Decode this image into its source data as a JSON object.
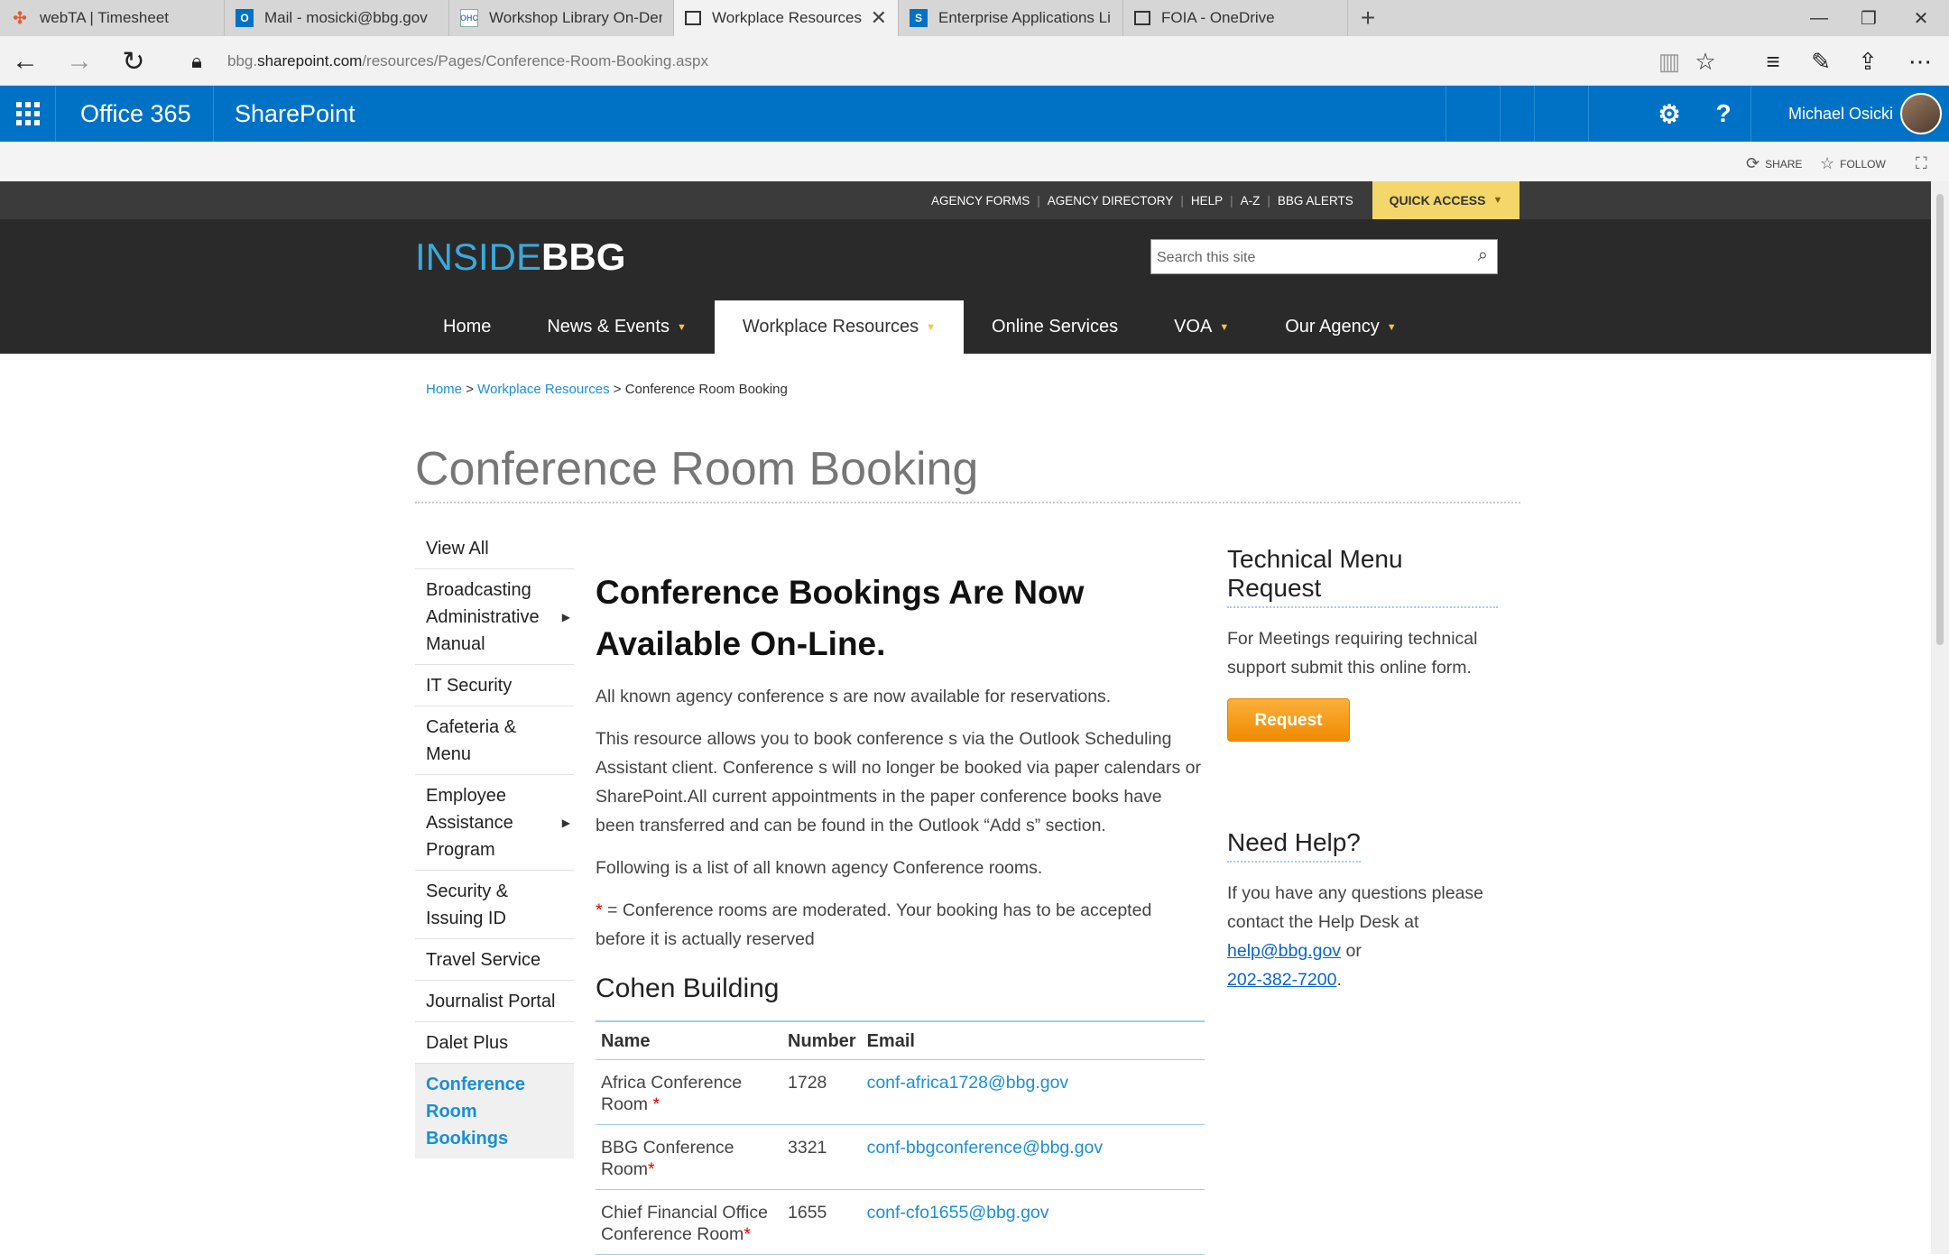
{
  "browser": {
    "tabs": [
      {
        "title": "webTA | Timesheet",
        "icon": "webta-favicon",
        "color": "#e65c2e"
      },
      {
        "title": "Mail - mosicki@bbg.gov",
        "icon": "outlook-favicon",
        "color": "#0072c6"
      },
      {
        "title": "Workshop Library On-Dema",
        "icon": "workshop-favicon",
        "color": "#5b7fa8"
      },
      {
        "title": "Workplace Resources Co",
        "icon": "page-favicon",
        "color": "#333333"
      },
      {
        "title": "Enterprise Applications Limi",
        "icon": "sharepoint-favicon",
        "color": "#0072c6"
      },
      {
        "title": "FOIA - OneDrive",
        "icon": "page-favicon",
        "color": "#333333"
      }
    ],
    "url_prefix": "bbg.",
    "url_domain": "sharepoint.com",
    "url_path": "/resources/Pages/Conference-Room-Booking.aspx"
  },
  "suite": {
    "office": "Office 365",
    "app": "SharePoint",
    "user": "Michael Osicki",
    "settings_glyph": "⚙",
    "help_glyph": "?"
  },
  "actions": {
    "share": "SHARE",
    "follow": "FOLLOW"
  },
  "util_links": [
    "AGENCY FORMS",
    "AGENCY DIRECTORY",
    "HELP",
    "A-Z",
    "BBG ALERTS"
  ],
  "quick_access": "QUICK ACCESS",
  "logo": {
    "part1": "INSIDE",
    "part2": "BBG"
  },
  "search_placeholder": "Search this site",
  "main_nav": [
    {
      "label": "Home",
      "dropdown": false
    },
    {
      "label": "News & Events",
      "dropdown": true
    },
    {
      "label": "Workplace Resources",
      "dropdown": true,
      "active": true
    },
    {
      "label": "Online Services",
      "dropdown": false
    },
    {
      "label": "VOA",
      "dropdown": true
    },
    {
      "label": "Our Agency",
      "dropdown": true
    }
  ],
  "breadcrumb": {
    "home": "Home",
    "section": "Workplace Resources",
    "current": "Conference Room Booking",
    "sep": ">"
  },
  "page_title": "Conference Room Booking",
  "left_nav": [
    {
      "label": "View All",
      "arrow": false
    },
    {
      "label": "Broadcasting Administrative Manual",
      "arrow": true
    },
    {
      "label": "IT Security",
      "arrow": false
    },
    {
      "label": "Cafeteria & Menu",
      "arrow": false
    },
    {
      "label": "Employee Assistance Program",
      "arrow": true
    },
    {
      "label": "Security & Issuing ID",
      "arrow": false
    },
    {
      "label": "Travel Service",
      "arrow": false
    },
    {
      "label": "Journalist Portal",
      "arrow": false
    },
    {
      "label": "Dalet Plus",
      "arrow": false
    },
    {
      "label": "Conference Room Bookings",
      "arrow": false,
      "current": true
    }
  ],
  "article": {
    "heading": "Conference Bookings Are Now Available On-Line.",
    "p1": "All known agency conference s are now available for reservations.",
    "p2": "This resource allows you to book conference s via the Outlook Scheduling Assistant client. Conference s will no longer be booked via paper calendars or SharePoint.All current appointments in the paper conference books have been transferred and can be found in the Outlook “Add s” section.",
    "p3": "Following is a list of all known agency Conference rooms.",
    "note_star": "*",
    "note": " = Conference rooms are moderated. Your booking has to be accepted before it is actually reserved",
    "building": "Cohen Building",
    "table_headers": [
      "Name",
      "Number",
      "Email"
    ],
    "rooms": [
      {
        "name": "Africa Conference Room ",
        "star": "*",
        "number": "1728",
        "email": "conf-africa1728@bbg.gov"
      },
      {
        "name": "BBG Conference Room",
        "star": "*",
        "number": "3321",
        "email": "conf-bbgconference@bbg.gov"
      },
      {
        "name": "Chief Financial Office Conference Room",
        "star": "*",
        "number": "1655",
        "email": "conf-cfo1655@bbg.gov"
      }
    ]
  },
  "sidebar": {
    "tech_title": "Technical Menu Request",
    "tech_text": "For Meetings requiring technical support submit this online form.",
    "request_button": "Request",
    "help_title": "Need Help?",
    "help_text": "If you have any questions please contact the Help Desk at",
    "help_email": "help@bbg.gov",
    "help_or": " or",
    "help_phone": "202-382-7200",
    "help_period": "."
  },
  "colors": {
    "suite_blue": "#0072c6",
    "link_blue": "#1a8fd5",
    "quick_access_yellow": "#f3d76a",
    "request_orange": "#f7a11a",
    "header_dark": "#2a2a2a"
  }
}
